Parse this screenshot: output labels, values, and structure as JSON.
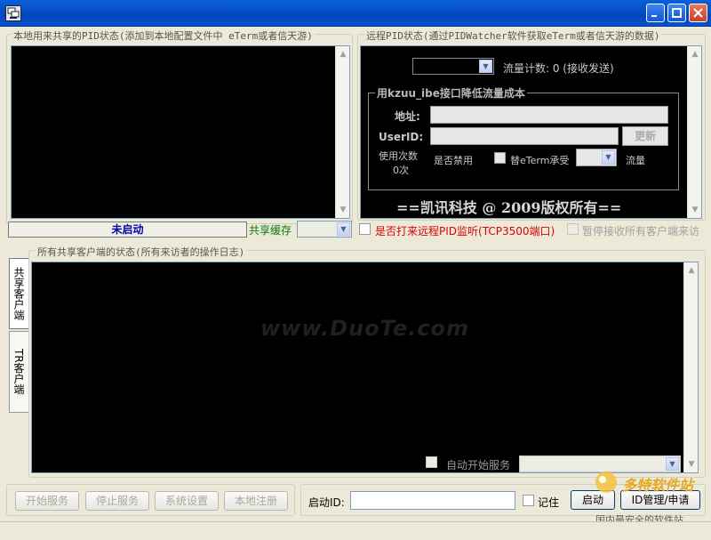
{
  "window": {
    "title": ""
  },
  "local": {
    "group_label": "本地用来共享的PID状态(添加到本地配置文件中 eTerm或者信天游)",
    "status": "未启动",
    "cache_label": "共享缓存"
  },
  "remote": {
    "group_label": "远程PID状态(通过PIDWatcher软件获取eTerm或者信天游的数据)",
    "traffic_label": "流量计数: 0 (接收发送)",
    "sub_group_label": "用kzuu_ibe接口降低流量成本",
    "address_label": "地址:",
    "userid_label": "UserID:",
    "refresh_button": "更新",
    "usage_label": "使用次数",
    "usage_value": "0次",
    "enable_label": "是否禁用",
    "inherit_label": "替eTerm承受",
    "flow_label": "流量",
    "copyright": "==凯讯科技 @ 2009版权所有=="
  },
  "options": {
    "remote_listen": "是否打来远程PID监听(TCP3500端口)",
    "pause_receive": "暂停接收所有客户端来访"
  },
  "clients": {
    "group_label": "所有共享客户端的状态(所有来访者的操作日志)",
    "tab_share": "共享客户端",
    "tab_tr": "TR客户端",
    "auto_start": "自动开始服务"
  },
  "toolbar": {
    "start_service": "开始服务",
    "stop_service": "停止服务",
    "system_settings": "系统设置",
    "local_register": "本地注册",
    "start_id_label": "启动ID:",
    "start_id_value": "",
    "remember_label": "记住",
    "start_button": "启动",
    "id_manage_button": "ID管理/申请"
  },
  "watermark": {
    "center": "www.DuoTe.com",
    "logo": "多特软件站",
    "slogan": "国内最安全的软件站"
  }
}
